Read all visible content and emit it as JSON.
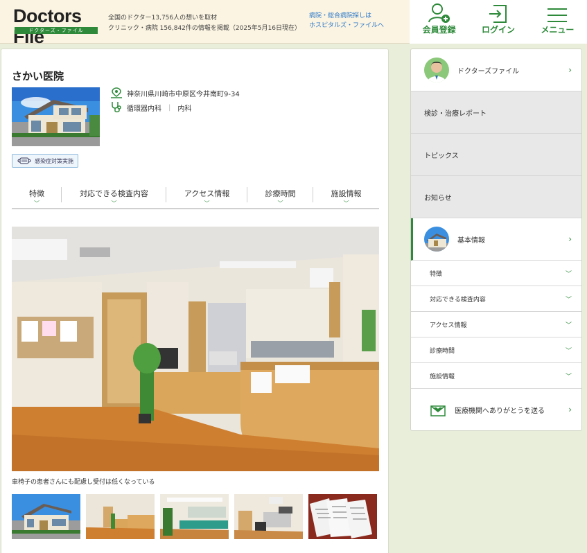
{
  "header": {
    "logo_main": "Doctors File",
    "logo_sub": "ドクターズ・ファイル",
    "info_line1": "全国のドクター13,756人の想いを取材",
    "info_line2": "クリニック・病院 156,842件の情報を掲載（2025年5月16日現在）",
    "link_line1": "病院・総合病院探しは",
    "link_line2": "ホスピタルズ・ファイルへ",
    "buttons": [
      {
        "label": "会員登録",
        "icon": "user-plus-icon"
      },
      {
        "label": "ログイン",
        "icon": "login-icon"
      },
      {
        "label": "メニュー",
        "icon": "hamburger-menu-icon"
      }
    ]
  },
  "clinic": {
    "name": "さかい医院",
    "address": "神奈川県川崎市中原区今井南町9-34",
    "departments": [
      "循環器内科",
      "内科"
    ],
    "badge": "感染症対策実施"
  },
  "tabs": [
    {
      "label": "特徴"
    },
    {
      "label": "対応できる検査内容"
    },
    {
      "label": "アクセス情報"
    },
    {
      "label": "診療時間"
    },
    {
      "label": "施設情報"
    }
  ],
  "photo_caption": "車椅子の患者さんにも配慮し受付は低くなっている",
  "sidebar": {
    "doctors_file": "ドクターズファイル",
    "report": "検診・治療レポート",
    "topics": "トピックス",
    "news": "お知らせ",
    "basic_info": "基本情報",
    "sub_items": [
      "特徴",
      "対応できる検査内容",
      "アクセス情報",
      "診療時間",
      "施設情報"
    ],
    "thanks": "医療機関へありがとうを送る"
  },
  "colors": {
    "brand_green": "#2e8a3a",
    "header_bg": "#fbf4e2",
    "page_bg": "#e9eedb",
    "link_blue": "#2b77c8"
  }
}
